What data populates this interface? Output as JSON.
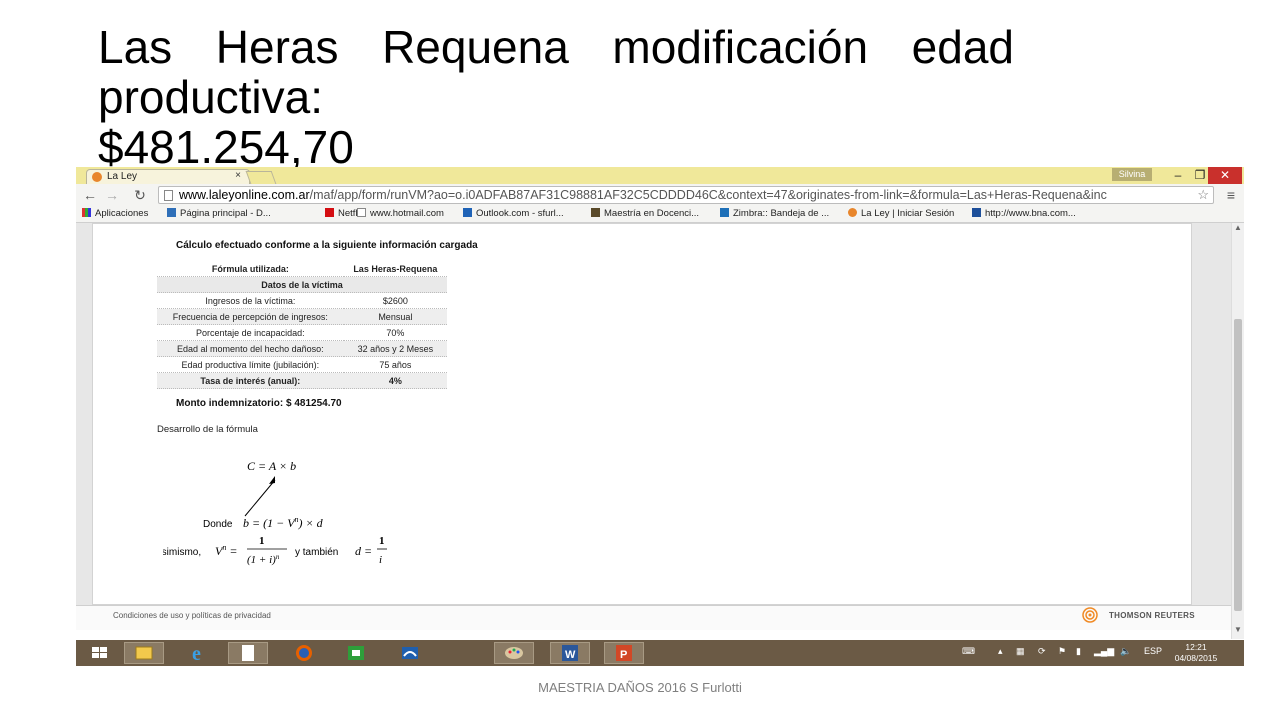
{
  "slide": {
    "title_line1": "Las Heras Requena modificación edad",
    "title_line2": "productiva:",
    "title_line3": "$481.254,70",
    "footer": "MAESTRIA DAÑOS 2016 S Furlotti"
  },
  "browser": {
    "tab_title": "La Ley",
    "tab_close": "×",
    "user": "Silvina",
    "url_host": "www.laleyonline.com.ar",
    "url_path": "/maf/app/form/runVM?ao=o.i0ADFAB87AF31C98881AF32C5CDDDD46C&context=47&originates-from-link=&formula=Las+Heras-Requena&inc",
    "bookmarks": [
      "Aplicaciones",
      "Página principal - D...",
      "Netflix",
      "www.hotmail.com",
      "Outlook.com - sfurl...",
      "Maestría en Docenci...",
      "Zimbra:: Bandeja de ...",
      "La Ley | Iniciar Sesión",
      "http://www.bna.com..."
    ],
    "bookmark_colors": [
      "#3a6fd8",
      "#2f6fb8",
      "#d40d12",
      "#2a66b0",
      "#1f63b7",
      "#5a4a2a",
      "#1e70b8",
      "#e8862c",
      "#1d4f9a"
    ]
  },
  "page": {
    "heading": "Cálculo efectuado conforme a la siguiente información cargada",
    "formula_row": {
      "label": "Fórmula utilizada:",
      "value": "Las Heras-Requena"
    },
    "victim_header": "Datos de la víctima",
    "rows": [
      {
        "label": "Ingresos de la víctima:",
        "value": "$2600"
      },
      {
        "label": "Frecuencia de percepción de ingresos:",
        "value": "Mensual"
      },
      {
        "label": "Porcentaje de incapacidad:",
        "value": "70%"
      },
      {
        "label": "Edad al momento del hecho dañoso:",
        "value": "32 años y 2 Meses"
      },
      {
        "label": "Edad productiva límite (jubilación):",
        "value": "75 años"
      }
    ],
    "rate_row": {
      "label": "Tasa de interés (anual):",
      "value": "4%"
    },
    "total": "Monto indemnizatorio: $ 481254.70",
    "dev_title": "Desarrollo de la fórmula",
    "formula": {
      "eq1": "C = A × b",
      "donde": "Donde",
      "asimismo": "Asimismo,",
      "y_tambien": "y también"
    },
    "footer_link": "Condiciones de uso y políticas de privacidad",
    "footer_brand": "THOMSON REUTERS"
  },
  "taskbar": {
    "language": "ESP",
    "time": "12:21",
    "date": "04/08/2015"
  }
}
